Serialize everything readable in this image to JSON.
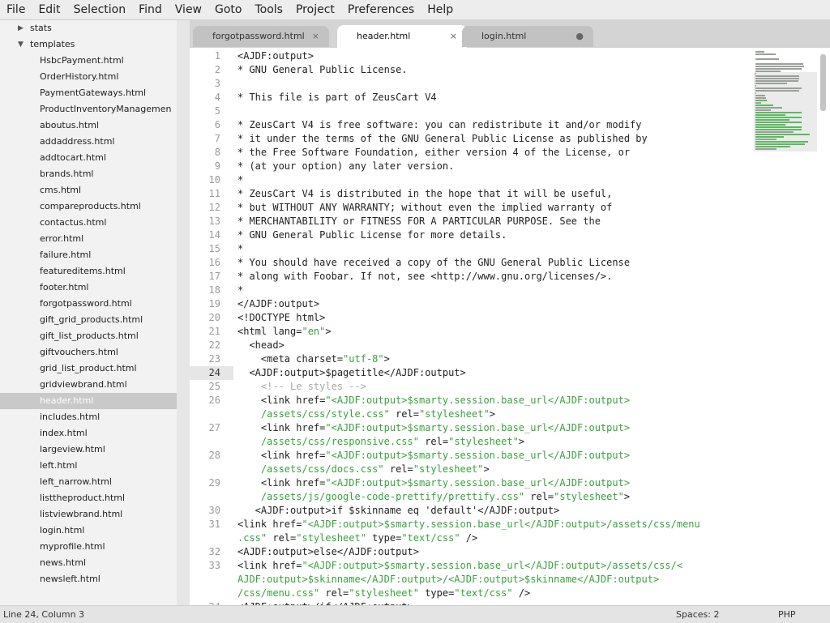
{
  "menubar": {
    "items": [
      "File",
      "Edit",
      "Selection",
      "Find",
      "View",
      "Goto",
      "Tools",
      "Project",
      "Preferences",
      "Help"
    ]
  },
  "sidebar": {
    "folders": [
      {
        "label": "stats",
        "expanded": false
      },
      {
        "label": "templates",
        "expanded": true
      }
    ],
    "files": [
      "HsbcPayment.html",
      "OrderHistory.html",
      "PaymentGateways.html",
      "ProductInventoryManagemen",
      "aboutus.html",
      "addaddress.html",
      "addtocart.html",
      "brands.html",
      "cms.html",
      "compareproducts.html",
      "contactus.html",
      "error.html",
      "failure.html",
      "featureditems.html",
      "footer.html",
      "forgotpassword.html",
      "gift_grid_products.html",
      "gift_list_products.html",
      "giftvouchers.html",
      "grid_list_product.html",
      "gridviewbrand.html",
      "header.html",
      "includes.html",
      "index.html",
      "largeview.html",
      "left.html",
      "left_narrow.html",
      "listtheproduct.html",
      "listviewbrand.html",
      "login.html",
      "myprofile.html",
      "news.html",
      "newsleft.html"
    ],
    "selected": "header.html"
  },
  "tabs": [
    {
      "label": "forgotpassword.html",
      "close": "×"
    },
    {
      "label": "header.html",
      "close": "×"
    },
    {
      "label": "login.html",
      "close": "●"
    }
  ],
  "editor": {
    "rows": [
      {
        "n": "1",
        "t": [
          [
            "<AJDF:output>",
            ""
          ]
        ]
      },
      {
        "n": "2",
        "t": [
          [
            "* GNU General Public License.",
            ""
          ]
        ]
      },
      {
        "n": "3",
        "t": [
          [
            "",
            ""
          ]
        ]
      },
      {
        "n": "4",
        "t": [
          [
            "* This file is part of ZeusCart V4",
            ""
          ]
        ]
      },
      {
        "n": "5",
        "t": [
          [
            "",
            ""
          ]
        ]
      },
      {
        "n": "6",
        "t": [
          [
            "* ZeusCart V4 is free software: you can redistribute it and/or modify",
            ""
          ]
        ]
      },
      {
        "n": "7",
        "t": [
          [
            "* it under the terms of the GNU General Public License as published by",
            ""
          ]
        ]
      },
      {
        "n": "8",
        "t": [
          [
            "* the Free Software Foundation, either version 4 of the License, or",
            ""
          ]
        ]
      },
      {
        "n": "9",
        "t": [
          [
            "* (at your option) any later version.",
            ""
          ]
        ]
      },
      {
        "n": "10",
        "t": [
          [
            "*",
            ""
          ]
        ]
      },
      {
        "n": "11",
        "t": [
          [
            "* ZeusCart V4 is distributed in the hope that it will be useful,",
            ""
          ]
        ]
      },
      {
        "n": "12",
        "t": [
          [
            "* but WITHOUT ANY WARRANTY; without even the implied warranty of",
            ""
          ]
        ]
      },
      {
        "n": "13",
        "t": [
          [
            "* MERCHANTABILITY or FITNESS FOR A PARTICULAR PURPOSE. See the",
            ""
          ]
        ]
      },
      {
        "n": "14",
        "t": [
          [
            "* GNU General Public License for more details.",
            ""
          ]
        ]
      },
      {
        "n": "15",
        "t": [
          [
            "*",
            ""
          ]
        ]
      },
      {
        "n": "16",
        "t": [
          [
            "* You should have received a copy of the GNU General Public License",
            ""
          ]
        ]
      },
      {
        "n": "17",
        "t": [
          [
            "* along with Foobar. If not, see <http://www.gnu.org/licenses/>.",
            ""
          ]
        ]
      },
      {
        "n": "18",
        "t": [
          [
            "*",
            ""
          ]
        ]
      },
      {
        "n": "19",
        "t": [
          [
            "</AJDF:output>",
            ""
          ]
        ]
      },
      {
        "n": "20",
        "t": [
          [
            "<!DOCTYPE html>",
            ""
          ]
        ]
      },
      {
        "n": "21",
        "t": [
          [
            "<html lang=",
            ""
          ],
          [
            "\"en\"",
            "str"
          ],
          [
            ">",
            ""
          ]
        ]
      },
      {
        "n": "22",
        "t": [
          [
            "  <head>",
            ""
          ]
        ]
      },
      {
        "n": "23",
        "t": [
          [
            "    <meta charset=",
            ""
          ],
          [
            "\"utf-8\"",
            "str"
          ],
          [
            ">",
            ""
          ]
        ]
      },
      {
        "n": "24",
        "t": [
          [
            "  <AJDF:output>$pagetitle</AJDF:output>",
            ""
          ]
        ]
      },
      {
        "n": "25",
        "t": [
          [
            "    ",
            ""
          ],
          [
            "<!-- Le styles -->",
            "cmt"
          ]
        ]
      },
      {
        "n": "26",
        "t": [
          [
            "    <link href=",
            ""
          ],
          [
            "\"<AJDF:output>$smarty.session.base_url</AJDF:output>",
            "str"
          ]
        ]
      },
      {
        "n": "",
        "t": [
          [
            "    ",
            ""
          ],
          [
            "/assets/css/style.css\"",
            "str"
          ],
          [
            " rel=",
            ""
          ],
          [
            "\"stylesheet\"",
            "str"
          ],
          [
            ">",
            ""
          ]
        ]
      },
      {
        "n": "27",
        "t": [
          [
            "    <link href=",
            ""
          ],
          [
            "\"<AJDF:output>$smarty.session.base_url</AJDF:output>",
            "str"
          ]
        ]
      },
      {
        "n": "",
        "t": [
          [
            "    ",
            ""
          ],
          [
            "/assets/css/responsive.css\"",
            "str"
          ],
          [
            " rel=",
            ""
          ],
          [
            "\"stylesheet\"",
            "str"
          ],
          [
            ">",
            ""
          ]
        ]
      },
      {
        "n": "28",
        "t": [
          [
            "    <link href=",
            ""
          ],
          [
            "\"<AJDF:output>$smarty.session.base_url</AJDF:output>",
            "str"
          ]
        ]
      },
      {
        "n": "",
        "t": [
          [
            "    ",
            ""
          ],
          [
            "/assets/css/docs.css\"",
            "str"
          ],
          [
            " rel=",
            ""
          ],
          [
            "\"stylesheet\"",
            "str"
          ],
          [
            ">",
            ""
          ]
        ]
      },
      {
        "n": "29",
        "t": [
          [
            "    <link href=",
            ""
          ],
          [
            "\"<AJDF:output>$smarty.session.base_url</AJDF:output>",
            "str"
          ]
        ]
      },
      {
        "n": "",
        "t": [
          [
            "    ",
            ""
          ],
          [
            "/assets/js/google-code-prettify/prettify.css\"",
            "str"
          ],
          [
            " rel=",
            ""
          ],
          [
            "\"stylesheet\"",
            "str"
          ],
          [
            ">",
            ""
          ]
        ]
      },
      {
        "n": "30",
        "t": [
          [
            "   <AJDF:output>if $skinname eq 'default'</AJDF:output>",
            ""
          ]
        ]
      },
      {
        "n": "31",
        "t": [
          [
            "<link href=",
            ""
          ],
          [
            "\"<AJDF:output>$smarty.session.base_url</AJDF:output>/assets/css/menu",
            "str"
          ]
        ]
      },
      {
        "n": "",
        "t": [
          [
            ".css\"",
            "str"
          ],
          [
            " rel=",
            ""
          ],
          [
            "\"stylesheet\"",
            "str"
          ],
          [
            " type=",
            ""
          ],
          [
            "\"text/css\"",
            "str"
          ],
          [
            " />",
            ""
          ]
        ]
      },
      {
        "n": "32",
        "t": [
          [
            "<AJDF:output>else</AJDF:output>",
            ""
          ]
        ]
      },
      {
        "n": "33",
        "t": [
          [
            "<link href=",
            ""
          ],
          [
            "\"<AJDF:output>$smarty.session.base_url</AJDF:output>/assets/css/<",
            "str"
          ]
        ]
      },
      {
        "n": "",
        "t": [
          [
            "AJDF:output>$skinname</AJDF:output>/<AJDF:output>$skinname</AJDF:output>",
            "str"
          ]
        ]
      },
      {
        "n": "",
        "t": [
          [
            "/css/menu.css\"",
            "str"
          ],
          [
            " rel=",
            ""
          ],
          [
            "\"stylesheet\"",
            "str"
          ],
          [
            " type=",
            ""
          ],
          [
            "\"text/css\"",
            "str"
          ],
          [
            " />",
            ""
          ]
        ]
      },
      {
        "n": "34",
        "t": [
          [
            "<AJDF:output>/if</AJDF:output>",
            ""
          ]
        ]
      }
    ],
    "current_line": "24"
  },
  "status": {
    "position": "Line 24, Column 3",
    "spaces": "Spaces: 2",
    "syntax": "PHP"
  },
  "colors": {
    "string": "#39a23f",
    "comment": "#a8a8a8",
    "selected_row": "#c9c9c9"
  }
}
